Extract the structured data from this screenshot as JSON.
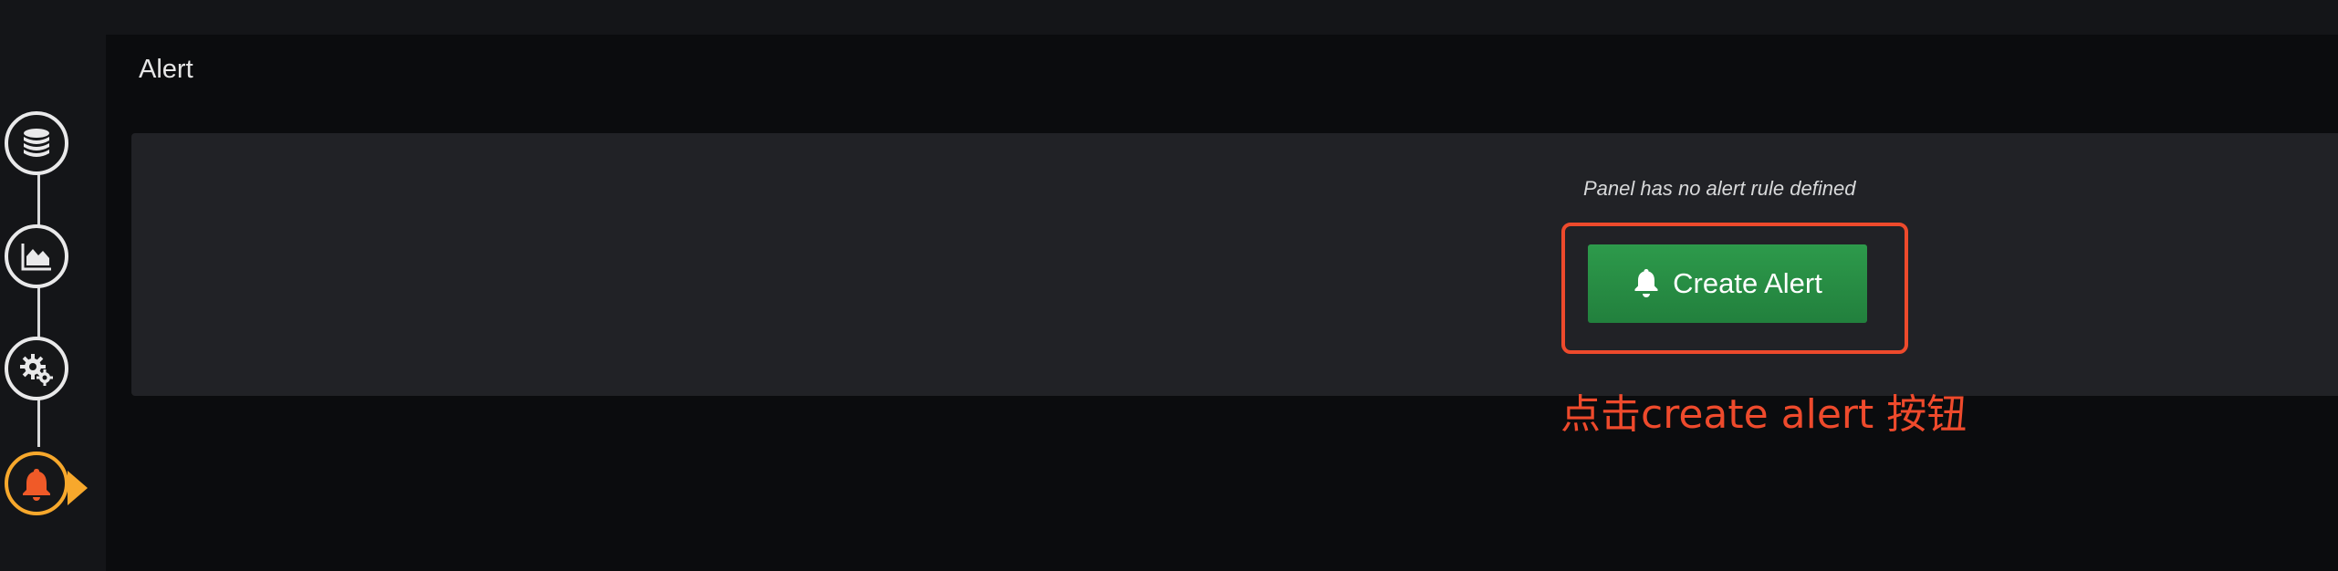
{
  "section": {
    "title": "Alert"
  },
  "sidebar": {
    "steps": [
      {
        "icon": "database-icon",
        "active": false
      },
      {
        "icon": "chart-area-icon",
        "active": false
      },
      {
        "icon": "gear-icon",
        "active": false
      },
      {
        "icon": "bell-icon",
        "active": true
      }
    ],
    "active_color": "#f7a82c"
  },
  "alert_panel": {
    "empty_message": "Panel has no alert rule defined",
    "create_button_label": "Create Alert",
    "create_button_icon": "bell-icon",
    "button_color": "#299c46"
  },
  "annotation": {
    "text": "点击create alert 按钮",
    "color": "#ee4a2c"
  }
}
